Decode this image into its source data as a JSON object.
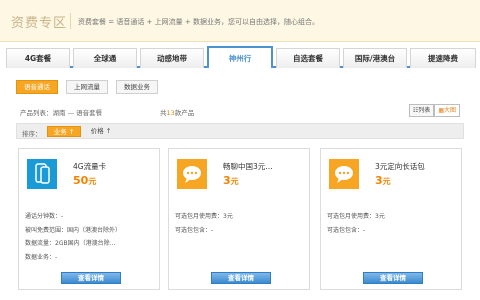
{
  "header": {
    "title": "资费专区",
    "description": "资费套餐 = 语音通话 + 上网流量 + 数据业务，您可以自由选择，随心组合。"
  },
  "tabs": [
    "4G套餐",
    "全球通",
    "动感地带",
    "神州行",
    "自选套餐",
    "国际/港澳台",
    "提速降费"
  ],
  "active_tab": "神州行",
  "filters": {
    "voice": "语音通话",
    "data": "上网流量",
    "service": "数据业务"
  },
  "list": {
    "breadcrumb": "产品列表：湖南 — 语音套餐",
    "count_prefix": "共",
    "count": "13",
    "count_suffix": "款产品",
    "view_list": "列表",
    "view_grid": "大图"
  },
  "sort": {
    "label": "排序：",
    "business": "业务",
    "price": "价格"
  },
  "products": [
    {
      "name": "4G流量卡",
      "price": "50",
      "unit": "元",
      "icon": "phone-icon",
      "details": [
        "通话分钟数：-",
        "被叫免费范围：国内（港澳台除外）",
        "数据流量：2GB国内（港澳台除…",
        "数据业务：-"
      ],
      "button": "查看详情"
    },
    {
      "name": "畅聊中国3元…",
      "price": "3",
      "unit": "元",
      "icon": "chat-icon",
      "details": [
        "可选包月使用费：3元",
        "可选包包含：-"
      ],
      "button": "查看详情"
    },
    {
      "name": "3元定向长话包",
      "price": "3",
      "unit": "元",
      "icon": "chat-icon",
      "details": [
        "可选包月使用费：3元",
        "可选包包含：-"
      ],
      "button": "查看详情"
    }
  ],
  "colors": {
    "accent_orange": "#f08300",
    "tab_blue": "#4e93cf",
    "icon_blue": "#1a9ad6",
    "icon_orange": "#f6a623"
  }
}
